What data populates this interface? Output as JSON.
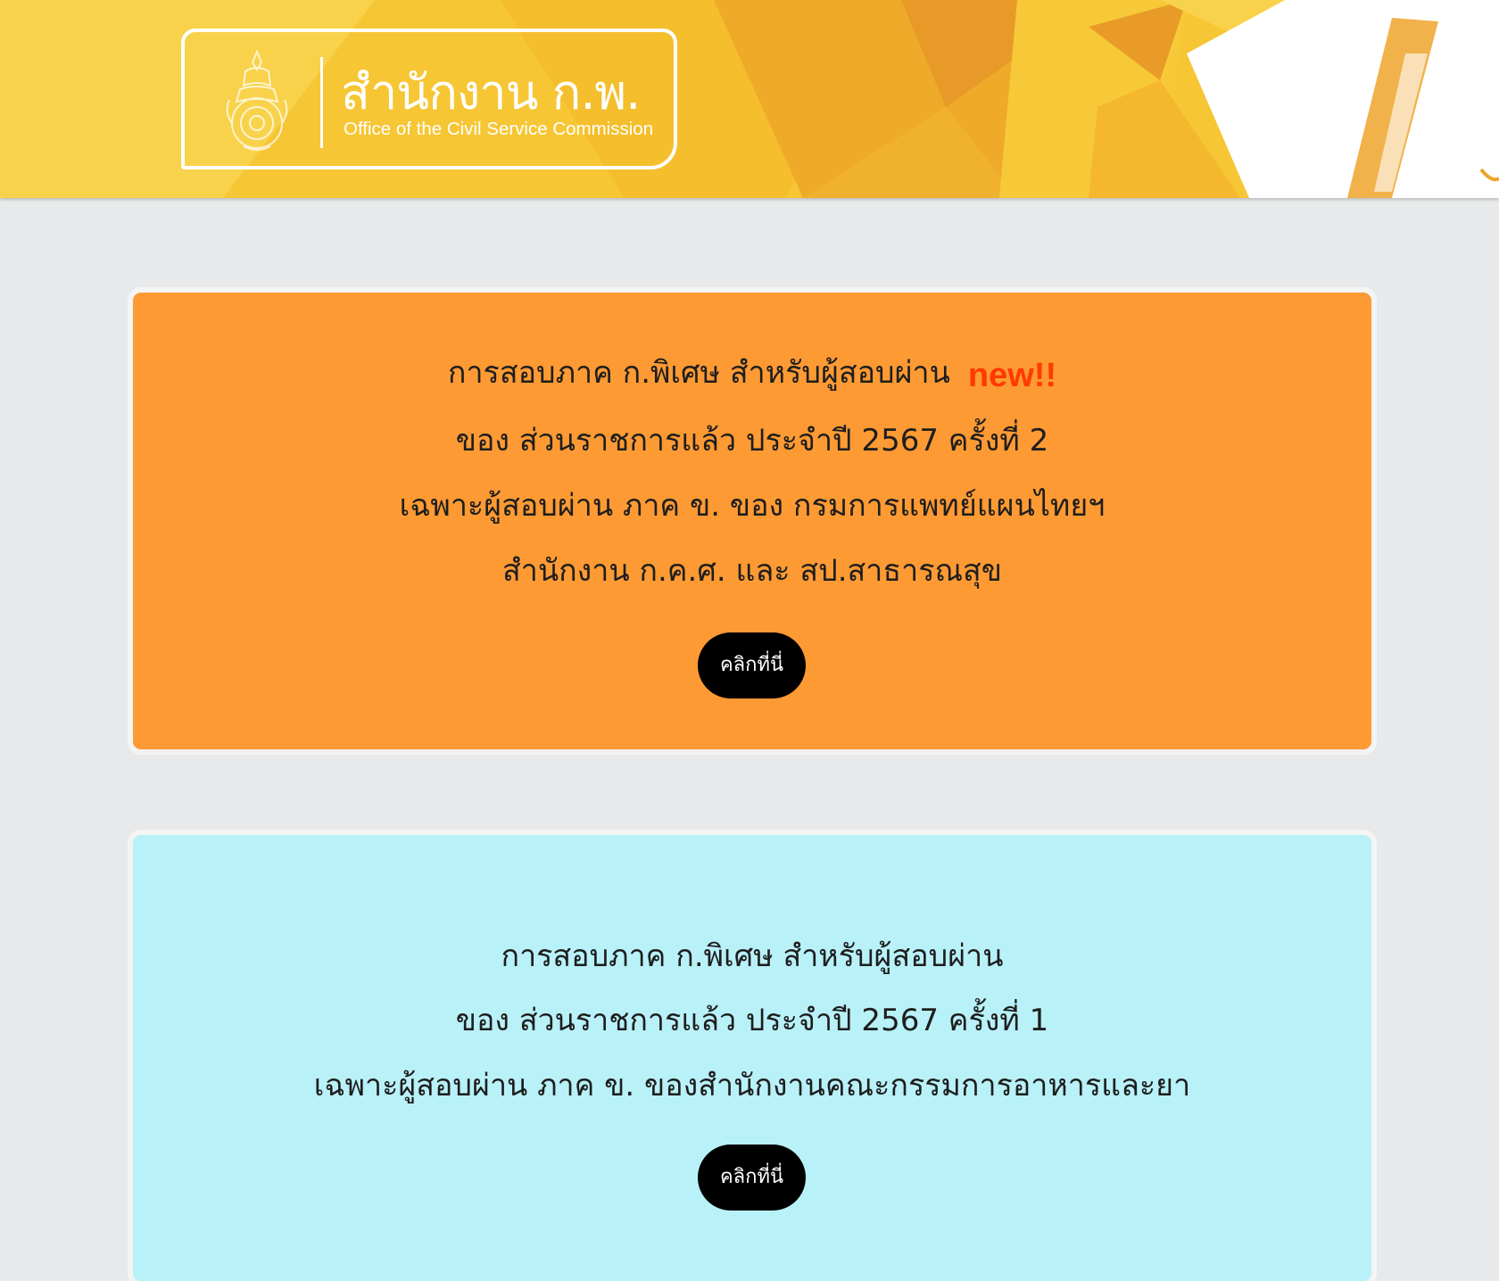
{
  "header": {
    "logo_title": "สำนักงาน ก.พ.",
    "logo_subtitle": "Office of the Civil Service Commission",
    "colors": {
      "banner_yellow": "#f7c431",
      "banner_orange": "#eca230",
      "logo_text": "#ffffff"
    }
  },
  "cards": [
    {
      "background": "#fd9a33",
      "lines": [
        "การสอบภาค ก.พิเศษ สำหรับผู้สอบผ่าน",
        "ของ ส่วนราชการแล้ว ประจำปี 2567 ครั้งที่ 2",
        "เฉพาะผู้สอบผ่าน ภาค ข. ของ กรมการแพทย์แผนไทยฯ",
        "สำนักงาน ก.ค.ศ. และ สป.สาธารณสุข"
      ],
      "badge": "new!!",
      "badge_color": "#ff3a00",
      "button_label": "คลิกที่นี่"
    },
    {
      "background": "#b9f1f8",
      "lines": [
        "การสอบภาค ก.พิเศษ สำหรับผู้สอบผ่าน",
        "ของ ส่วนราชการแล้ว ประจำปี 2567 ครั้งที่ 1",
        "เฉพาะผู้สอบผ่าน ภาค ข. ของสำนักงานคณะกรรมการอาหารและยา"
      ],
      "button_label": "คลิกที่นี่"
    }
  ]
}
